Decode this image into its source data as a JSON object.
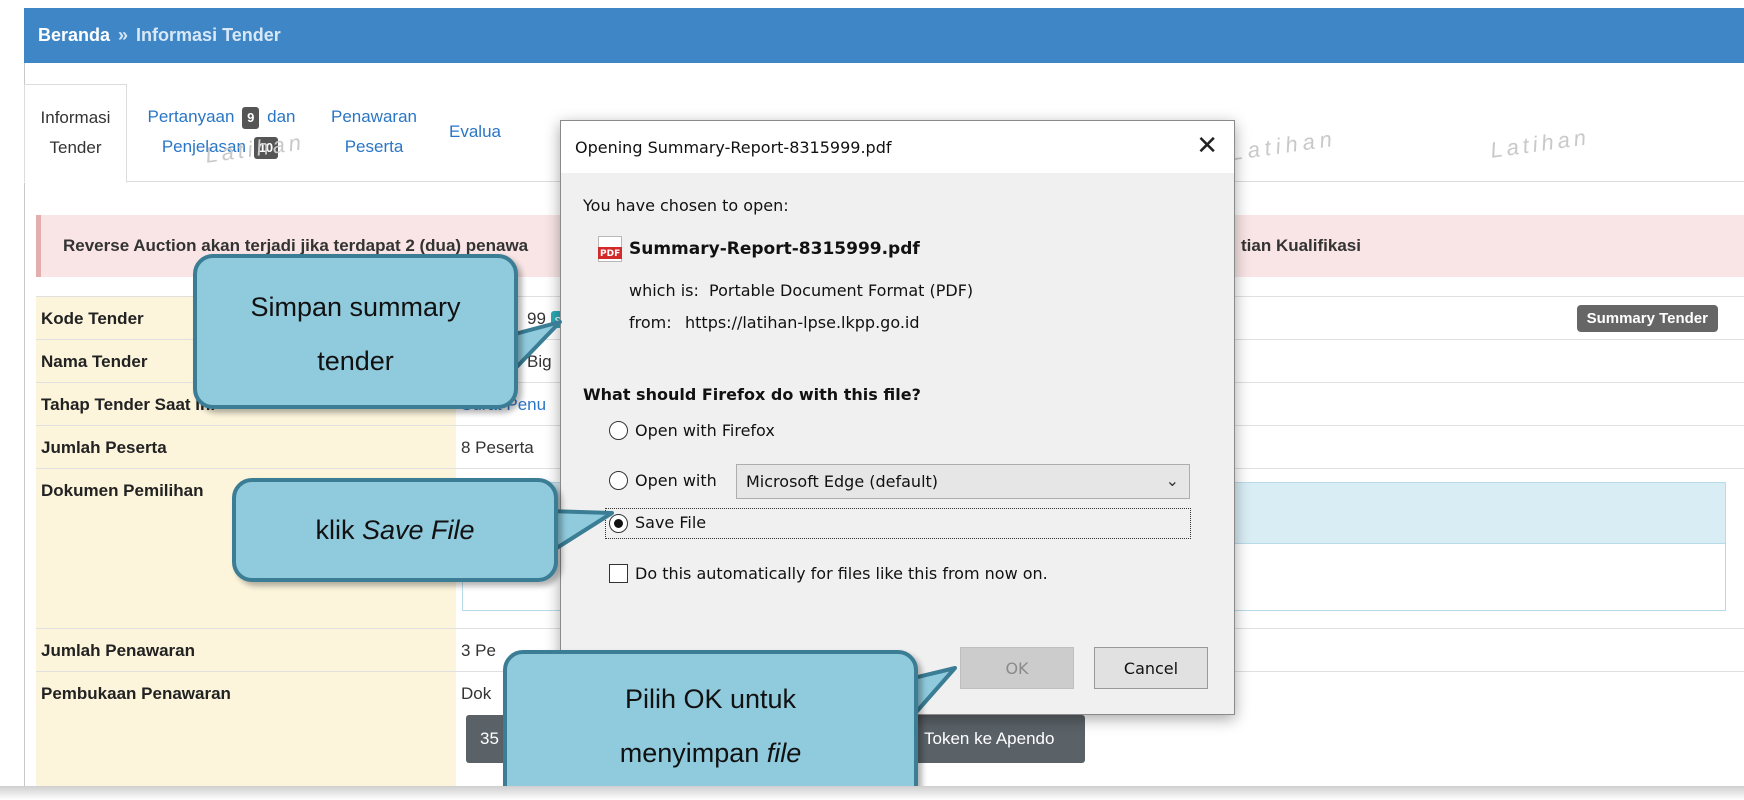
{
  "breadcrumb": {
    "home": "Beranda",
    "separator": "»",
    "current": "Informasi Tender"
  },
  "tabs": [
    {
      "line1": "Informasi",
      "line2": "Tender"
    },
    {
      "line1_a": "Pertanyaan",
      "badge1": "9",
      "line1_b": "dan",
      "line2_a": "Penjelasan",
      "badge2": "10"
    },
    {
      "line1": "Penawaran",
      "line2": "Peserta"
    },
    {
      "line1": "Evalua"
    }
  ],
  "watermark": "Latihan",
  "alert": {
    "text_start": "Reverse Auction akan terjadi jika terdapat 2 (dua) penawa",
    "text_end": "tian Kualifikasi"
  },
  "table": {
    "kode_label": "Kode Tender",
    "kode_value": "99",
    "kode_badge": "s",
    "summary_button": "Summary Tender",
    "nama_label": "Nama Tender",
    "nama_value": "Big",
    "tahap_label": "Tahap Tender Saat Ini",
    "tahap_value": "Surat Penu",
    "jumlah_peserta_label": "Jumlah Peserta",
    "jumlah_peserta_value": "8 Peserta",
    "dokumen_label": "Dokumen Pemilihan",
    "jumlah_penawaran_label": "Jumlah Penawaran",
    "jumlah_penawaran_value": "3 Pe",
    "pembukaan_label": "Pembukaan Penawaran",
    "pembukaan_value": "Dok",
    "pembukaan_btn_left": "35",
    "pembukaan_btn_right": "Token ke Apendo"
  },
  "dialog": {
    "title": "Opening Summary-Report-8315999.pdf",
    "close_glyph": "✕",
    "chosen_text": "You have chosen to open:",
    "filename": "Summary-Report-8315999.pdf",
    "pdf_icon_text": "PDF",
    "which_is_label": "which is:",
    "which_is_value": "Portable Document Format (PDF)",
    "from_label": "from:",
    "from_value": "https://latihan-lpse.lkpp.go.id",
    "question": "What should Firefox do with this file?",
    "option_open_firefox": "Open with Firefox",
    "option_open_with": "Open with",
    "open_with_app": "Microsoft Edge (default)",
    "option_save": "Save File",
    "auto_checkbox": "Do this automatically for files like this from now on.",
    "ok_button": "OK",
    "cancel_button": "Cancel"
  },
  "callouts": {
    "simpan_line1": "Simpan summary",
    "simpan_line2": "tender",
    "klik_prefix": "klik ",
    "klik_italic": "Save File",
    "pilih_line1": "Pilih OK untuk",
    "pilih_line2_prefix": "menyimpan ",
    "pilih_line2_italic": "file"
  },
  "colors": {
    "header_blue": "#3f86c7",
    "callout_fill": "#8fcadd",
    "callout_border": "#3a7d94",
    "label_bg": "#fcf5dc",
    "alert_bg": "#f9e5e5"
  }
}
